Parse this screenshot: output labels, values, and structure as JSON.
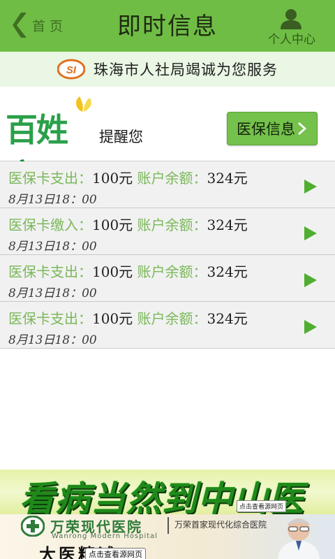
{
  "header": {
    "back_label": "首 页",
    "title": "即时信息",
    "user_label": "个人中心"
  },
  "service_banner": {
    "text": "珠海市人社局竭诚为您服务",
    "logo_text": "SI"
  },
  "brand": {
    "name_part1": "百姓",
    "name_part2": "康",
    "remind_text": "提醒您",
    "info_button_label": "医保信息"
  },
  "records": [
    {
      "type": "医保卡支出：",
      "amount": "100元",
      "balance_label": "账户余额：",
      "balance": "324元",
      "date": "8月13日18：00"
    },
    {
      "type": "医保卡缴入：",
      "amount": "100元",
      "balance_label": "账户余额：",
      "balance": "324元",
      "date": "8月13日18：00"
    },
    {
      "type": "医保卡支出：",
      "amount": "100元",
      "balance_label": "账户余额：",
      "balance": "324元",
      "date": "8月13日18：00"
    },
    {
      "type": "医保卡支出：",
      "amount": "100元",
      "balance_label": "账户余额：",
      "balance": "324元",
      "date": "8月13日18：00"
    }
  ],
  "ads": {
    "ad1_text": "看病当然到中山医院",
    "ad1_tag": "点击查看源网页",
    "ad2_name": "万荣现代医院",
    "ad2_en": "Wanrong Modern Hospital",
    "ad2_slogan": "万荣首家现代化综合医院",
    "ad2_big": "大医精诚",
    "ad2_tag": "点击查看源网页"
  },
  "colors": {
    "top_bar": "#6fbd45",
    "accent_green": "#7ab85a",
    "service_bg": "#e9f7e4",
    "row_bg": "#f1f1f1",
    "button_green": "#74c14c"
  },
  "icons": {
    "back": "chevron-left-icon",
    "user": "user-icon",
    "row_arrow": "play-arrow-icon",
    "button_arrow": "chevron-right-icon"
  }
}
